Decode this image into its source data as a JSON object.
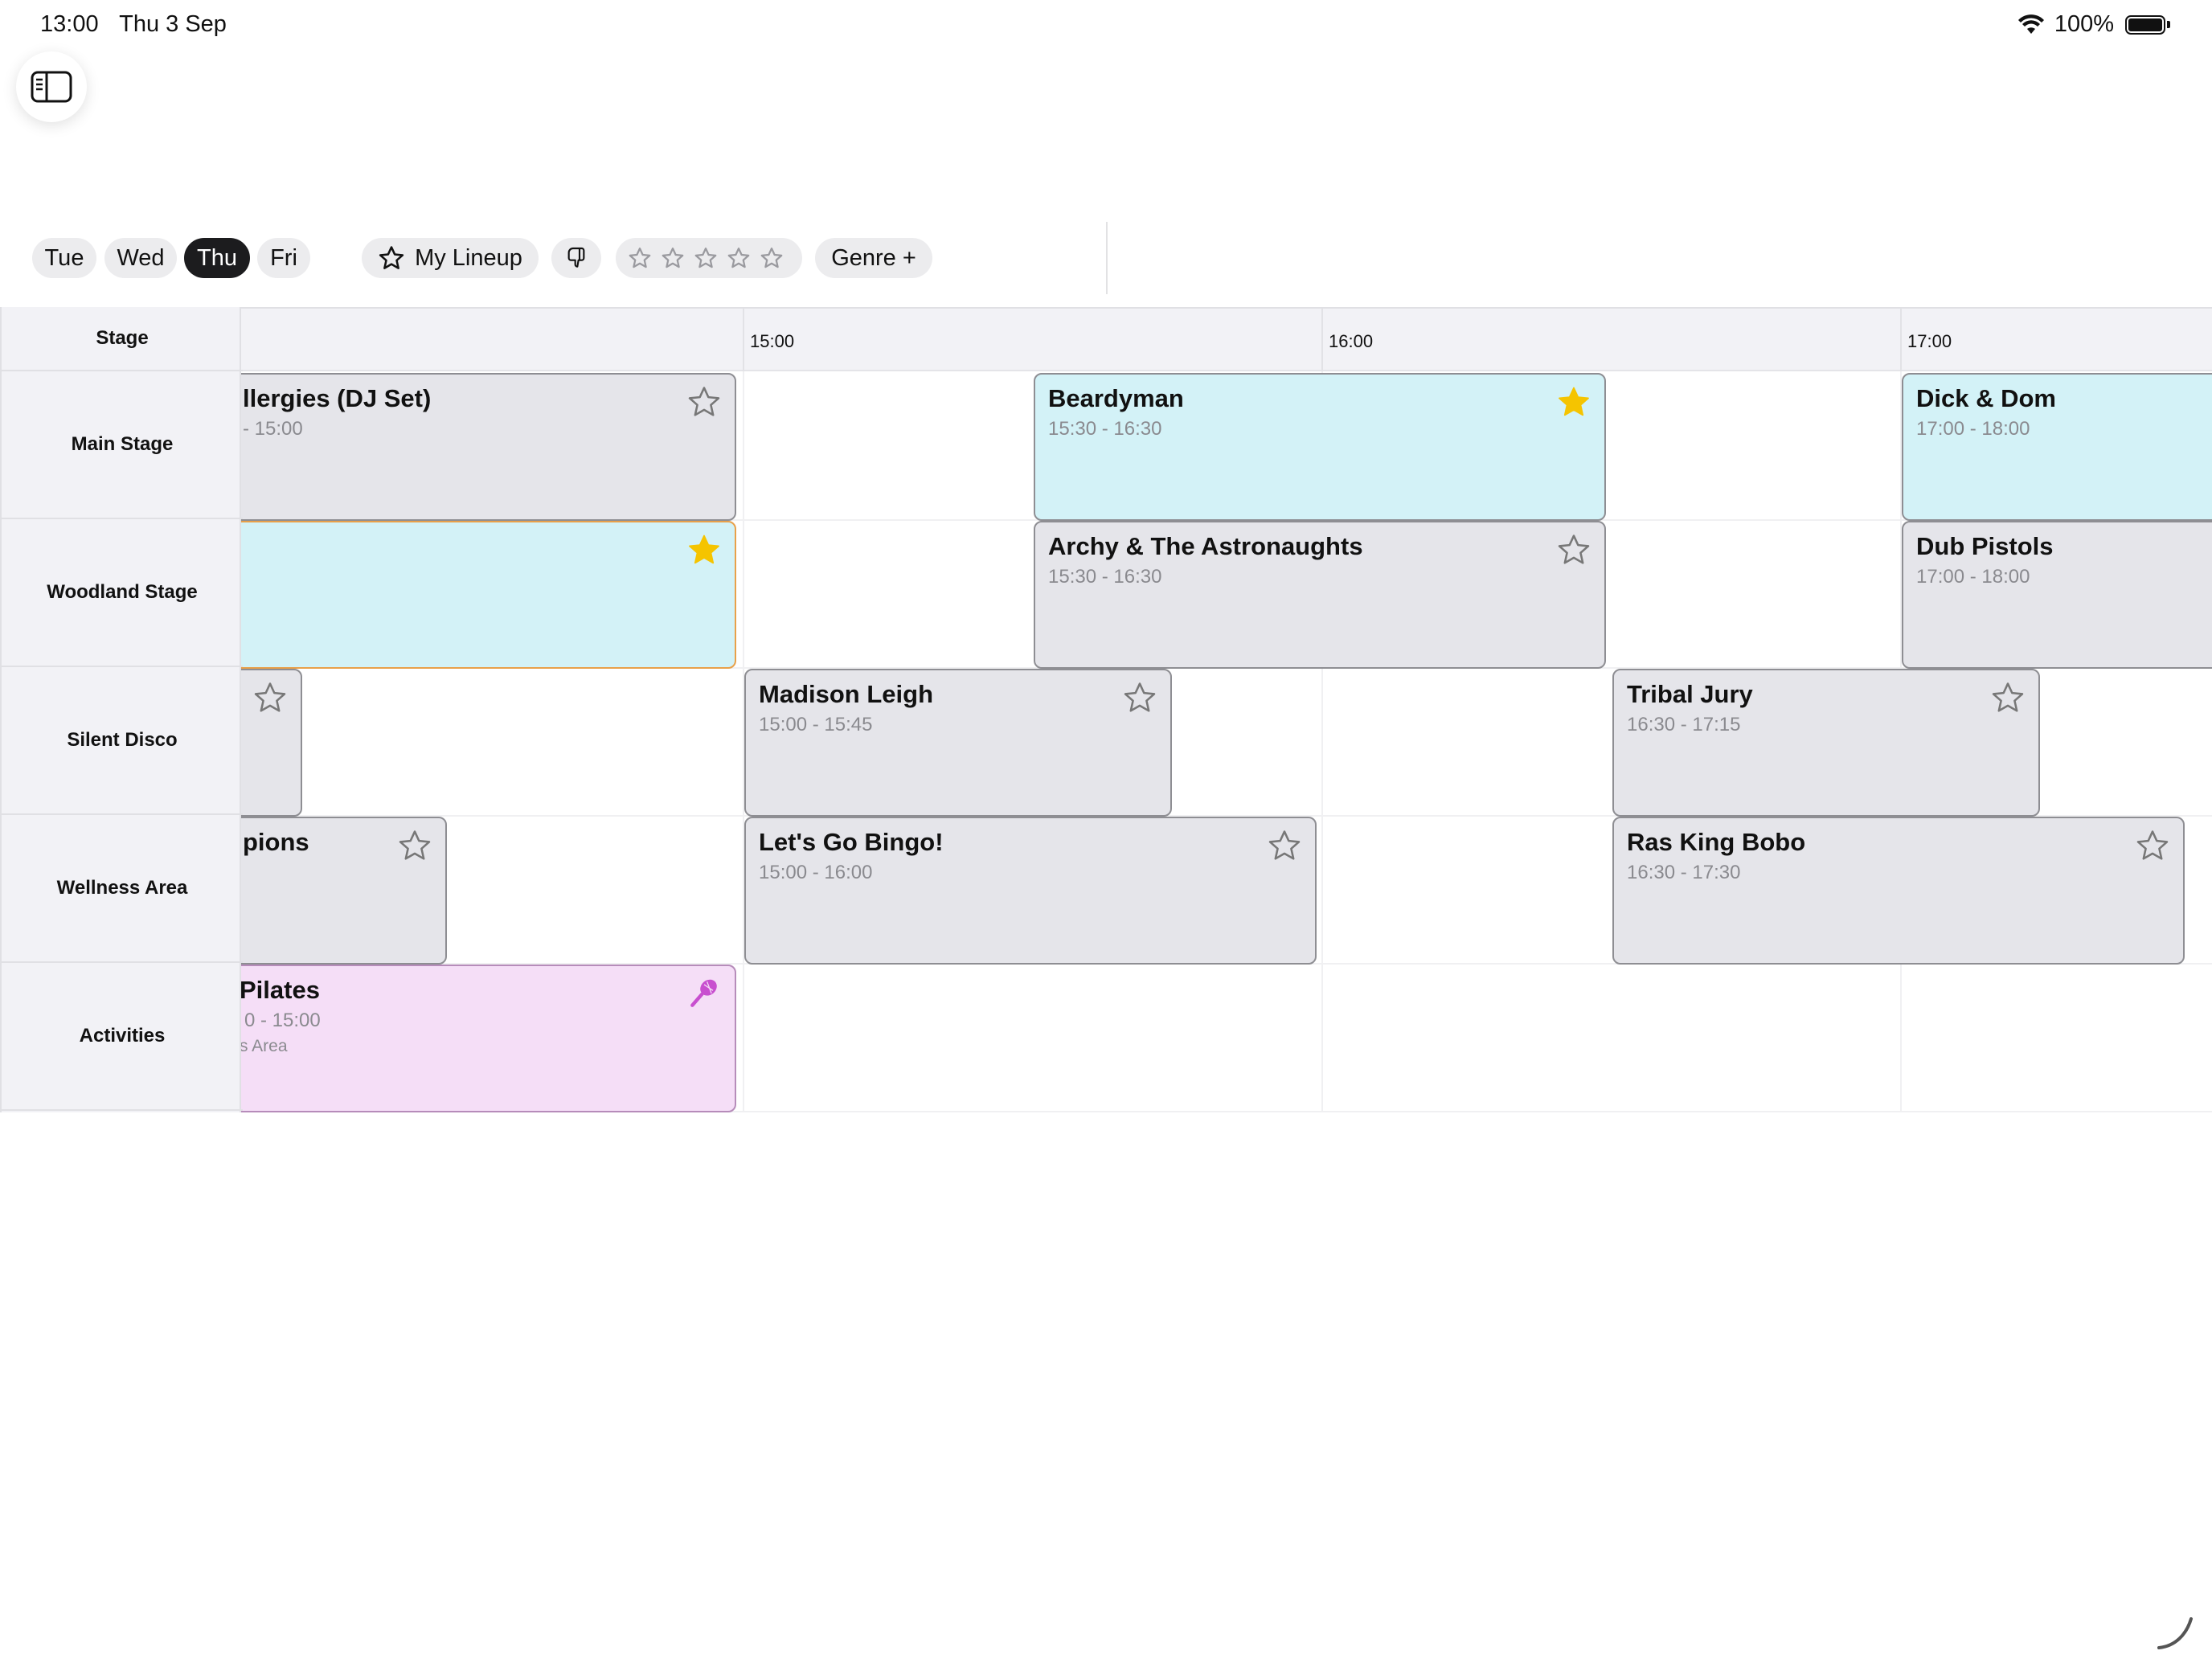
{
  "status_bar": {
    "time": "13:00",
    "date": "Thu 3 Sep",
    "battery": "100%"
  },
  "days": [
    {
      "label": "Tue",
      "active": false
    },
    {
      "label": "Wed",
      "active": false
    },
    {
      "label": "Thu",
      "active": true
    },
    {
      "label": "Fri",
      "active": false
    }
  ],
  "filters": {
    "my_lineup": "My Lineup",
    "genre": "Genre +"
  },
  "grid": {
    "stage_header": "Stage",
    "ticks": [
      "15:00",
      "16:00",
      "17:00"
    ],
    "stages": [
      "Main Stage",
      "Woodland Stage",
      "Silent Disco",
      "Wellness Area",
      "Activities"
    ]
  },
  "events": [
    {
      "name": "llergies (DJ Set)",
      "time": "- 15:00",
      "stage": "Main Stage",
      "favorite": false
    },
    {
      "name": "Beardyman",
      "time": "15:30 - 16:30",
      "stage": "Main Stage",
      "favorite": true
    },
    {
      "name": "Dick & Dom",
      "time": "17:00 - 18:00",
      "stage": "Main Stage",
      "favorite": true
    },
    {
      "name": "",
      "time": "",
      "stage": "Woodland Stage",
      "favorite": true
    },
    {
      "name": "Archy & The Astronaughts",
      "time": "15:30 - 16:30",
      "stage": "Woodland Stage",
      "favorite": false
    },
    {
      "name": "Dub Pistols",
      "time": "17:00 - 18:00",
      "stage": "Woodland Stage",
      "favorite": false
    },
    {
      "name": "",
      "time": "",
      "stage": "Silent Disco",
      "favorite": false
    },
    {
      "name": "Madison Leigh",
      "time": "15:00 - 15:45",
      "stage": "Silent Disco",
      "favorite": false
    },
    {
      "name": "Tribal Jury",
      "time": "16:30 - 17:15",
      "stage": "Silent Disco",
      "favorite": false
    },
    {
      "name": "pions",
      "time": "",
      "stage": "Wellness Area",
      "favorite": false
    },
    {
      "name": "Let's Go Bingo!",
      "time": "15:00 - 16:00",
      "stage": "Wellness Area",
      "favorite": false
    },
    {
      "name": "Ras King Bobo",
      "time": "16:30 - 17:30",
      "stage": "Wellness Area",
      "favorite": false
    },
    {
      "name": "Pilates",
      "time": "0 - 15:00",
      "location": "s Area",
      "stage": "Activities",
      "icon": "racket-icon"
    }
  ],
  "colors": {
    "favorite_bg": "#d3f2f7",
    "default_bg": "#e5e5ea",
    "activity_bg": "#f5def7",
    "star_gold": "#f5c400",
    "active_pill": "#1c1c1e"
  }
}
